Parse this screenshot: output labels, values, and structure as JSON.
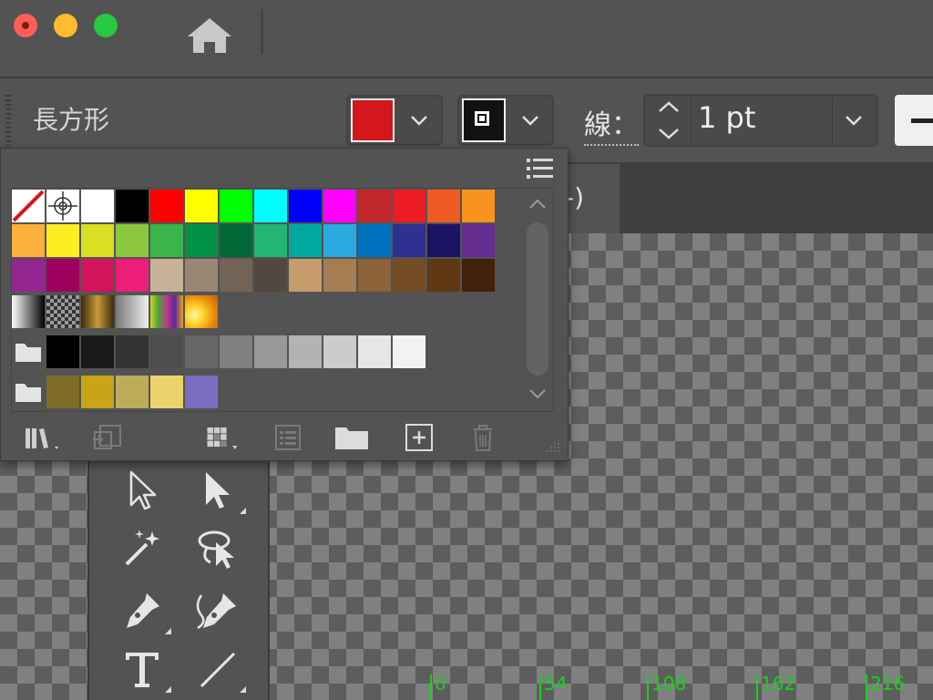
{
  "window": {
    "controls": [
      "close",
      "minimize",
      "maximize"
    ]
  },
  "control_bar": {
    "shape_name": "長方形",
    "fill_color": "#d4171c",
    "stroke_color": "#111111",
    "stroke_label": "線：",
    "stroke_weight": "1 pt"
  },
  "document": {
    "tab_title_fragment": "-)"
  },
  "swatches": {
    "rows": [
      [
        "none",
        "registration",
        "#ffffff",
        "#000000",
        "#ff0000",
        "#ffff00",
        "#00ff00",
        "#00ffff",
        "#0000ff",
        "#ff00ff",
        "#c1272d",
        "#ed1c24",
        "#f15a24",
        "#f7931e"
      ],
      [
        "#fbb03b",
        "#fcee21",
        "#d9e021",
        "#8cc63f",
        "#39b54a",
        "#009245",
        "#006837",
        "#22b573",
        "#00a99d",
        "#29abe2",
        "#0071bc",
        "#2e3192",
        "#1b1464",
        "#662d91"
      ],
      [
        "#93278f",
        "#9e005d",
        "#d4145a",
        "#ed1e79",
        "#c7b299",
        "#998675",
        "#736357",
        "#534741",
        "#c69c6d",
        "#a67c52",
        "#8c6239",
        "#754c24",
        "#603813",
        "#42210b"
      ]
    ],
    "gradients": [
      "gradient-white-black",
      "gradient-checker-fade",
      "gradient-brown-gold",
      "gradient-fade",
      "gradient-rainbow",
      "pattern-flame"
    ],
    "gray_group": [
      "#000000",
      "#1a1a1a",
      "#333333",
      "#4d4d4d",
      "#666666",
      "#808080",
      "#999999",
      "#b3b3b3",
      "#cccccc",
      "#e6e6e6",
      "#f2f2f2"
    ],
    "color_group": [
      "#806b2a",
      "#c9a416",
      "#bfac5b",
      "#ecd26b",
      "#7b6dbf"
    ]
  },
  "ruler": {
    "labels": [
      "0",
      "54",
      "108",
      "162",
      "216"
    ]
  },
  "icons": {
    "home": "home-icon",
    "panel_menu": "panel-menu-icon",
    "libraries": "swatch-libraries-icon",
    "place": "place-swatches-icon",
    "kind": "swatch-kind-icon",
    "options": "swatch-options-icon",
    "new_group": "new-color-group-icon",
    "new_swatch": "new-swatch-icon",
    "delete": "delete-swatch-icon"
  }
}
